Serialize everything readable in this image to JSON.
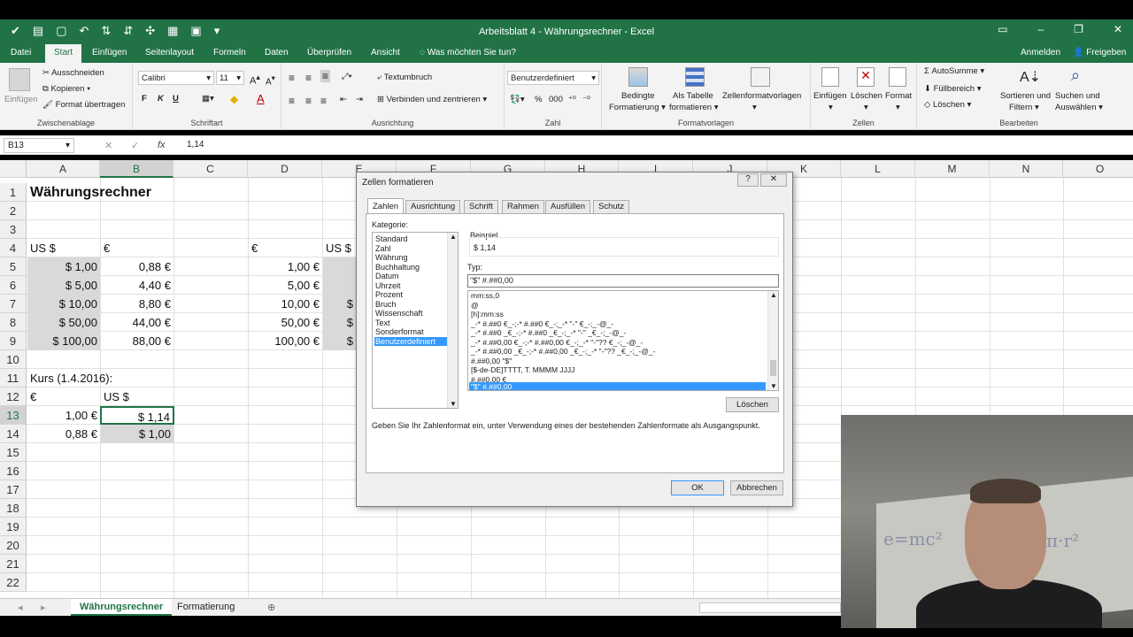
{
  "window": {
    "title": "Arbeitsblatt 4 - Währungsrechner - Excel",
    "accent": "#217346"
  },
  "ribbon_tabs": [
    "Datei",
    "Start",
    "Einfügen",
    "Seitenlayout",
    "Formeln",
    "Daten",
    "Überprüfen",
    "Ansicht"
  ],
  "tellme": "Was möchten Sie tun?",
  "signin": "Anmelden",
  "share": "Freigeben",
  "ribbon": {
    "paste": "Einfügen",
    "cut": "Ausschneiden",
    "copy": "Kopieren",
    "format_painter": "Format übertragen",
    "clipboard_group": "Zwischenablage",
    "font_name": "Calibri",
    "font_size": "11",
    "bold": "F",
    "italic": "K",
    "underline": "U",
    "font_group": "Schriftart",
    "wrap_text": "Textumbruch",
    "merge_center": "Verbinden und zentrieren",
    "alignment_group": "Ausrichtung",
    "number_format": "Benutzerdefiniert",
    "number_group": "Zahl",
    "cond_format_1": "Bedingte",
    "cond_format_2": "Formatierung",
    "as_table_1": "Als Tabelle",
    "as_table_2": "formatieren",
    "cell_styles": "Zellenformatvorlagen",
    "styles_group": "Formatvorlagen",
    "insert": "Einfügen",
    "delete": "Löschen",
    "format": "Format",
    "cells_group": "Zellen",
    "autosum": "AutoSumme",
    "fill": "Füllbereich",
    "clear": "Löschen",
    "sort_1": "Sortieren und",
    "sort_2": "Filtern",
    "find_1": "Suchen und",
    "find_2": "Auswählen",
    "editing_group": "Bearbeiten"
  },
  "formula_bar": {
    "name_box": "B13",
    "fx": "fx",
    "value": "1,14"
  },
  "columns": [
    "A",
    "B",
    "C",
    "D",
    "E",
    "F",
    "G",
    "H",
    "I",
    "J",
    "K",
    "L",
    "M",
    "N",
    "O"
  ],
  "rows": [
    "1",
    "2",
    "3",
    "4",
    "5",
    "6",
    "7",
    "8",
    "9",
    "10",
    "11",
    "12",
    "13",
    "14",
    "15",
    "16",
    "17",
    "18",
    "19",
    "20",
    "21",
    "22"
  ],
  "cells": {
    "A1": "Währungsrechner",
    "A4": "US $",
    "B4": "€",
    "D4": "€",
    "E4": "US $",
    "A5": "$ 1,00",
    "B5": "0,88 €",
    "D5": "1,00 €",
    "A6": "$ 5,00",
    "B6": "4,40 €",
    "D6": "5,00 €",
    "A7": "$ 10,00",
    "B7": "8,80 €",
    "D7": "10,00 €",
    "E7": "$",
    "A8": "$ 50,00",
    "B8": "44,00 €",
    "D8": "50,00 €",
    "E8": "$",
    "A9": "$ 100,00",
    "B9": "88,00 €",
    "D9": "100,00 €",
    "E9": "$",
    "A11": "Kurs (1.4.2016):",
    "A12": "€",
    "B12": "US $",
    "A13": "1,00 €",
    "B13": "$ 1,14",
    "A14": "0,88 €",
    "B14": "$ 1,00"
  },
  "sheets": [
    "Währungsrechner",
    "Formatierung"
  ],
  "dialog": {
    "title": "Zellen formatieren",
    "help": "?",
    "close": "✕",
    "tabs": [
      "Zahlen",
      "Ausrichtung",
      "Schrift",
      "Rahmen",
      "Ausfüllen",
      "Schutz"
    ],
    "kategorie_label": "Kategorie:",
    "kategorien": [
      "Standard",
      "Zahl",
      "Währung",
      "Buchhaltung",
      "Datum",
      "Uhrzeit",
      "Prozent",
      "Bruch",
      "Wissenschaft",
      "Text",
      "Sonderformat",
      "Benutzerdefiniert"
    ],
    "selected_kategorie": "Benutzerdefiniert",
    "beispiel_label": "Beispiel",
    "beispiel_value": "$ 1,14",
    "typ_label": "Typ:",
    "typ_value": "\"$\" #.##0,00",
    "formats": [
      "mm:ss,0",
      "@",
      "[h]:mm:ss",
      "_-* #.##0 €_-;-* #.##0 €_-;_-* \"-\" €_-;_-@_-",
      "_-* #.##0 _€_-;-* #.##0 _€_-;_-* \"-\" _€_-;_-@_-",
      "_-* #.##0,00 €_-;-* #.##0,00 €_-;_-* \"-\"?? €_-;_-@_-",
      "_-* #.##0,00 _€_-;-* #.##0,00 _€_-;_-* \"-\"?? _€_-;_-@_-",
      "#.##0,00 \"$\"",
      "[$-de-DE]TTTT, T. MMMM JJJJ",
      "#.##0,00 €",
      "\"$\" #.##0,00"
    ],
    "selected_format": "\"$\" #.##0,00",
    "delete_button": "Löschen",
    "hint": "Geben Sie Ihr Zahlenformat ein, unter Verwendung eines der bestehenden Zahlenformate als Ausgangspunkt.",
    "ok": "OK",
    "cancel": "Abbrechen"
  },
  "webcam": {
    "board_text_1": "e=mc²",
    "board_text_2": "π·r²"
  }
}
